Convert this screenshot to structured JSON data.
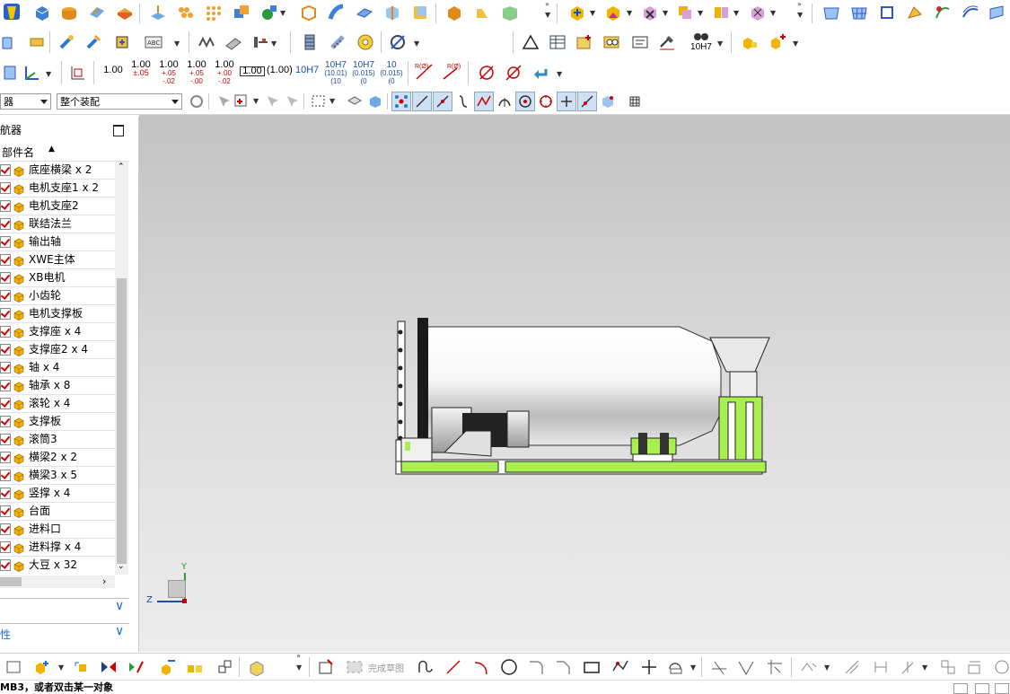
{
  "toolbar_row3": {
    "tolerance_buttons": [
      {
        "main": "1.00",
        "sub": ""
      },
      {
        "main": "1.00",
        "sub": "±.05"
      },
      {
        "main": "1.00",
        "sub": "+.05",
        "sub2": "-.02"
      },
      {
        "main": "1.00",
        "sub": "+.05",
        "sub2": "-.00"
      },
      {
        "main": "1.00",
        "sub": "+.00",
        "sub2": "-.02"
      },
      {
        "main": "1.00",
        "sub": ""
      },
      {
        "main": "(1.00)",
        "sub": ""
      },
      {
        "main": "10H7",
        "sub": ""
      },
      {
        "main": "10H7",
        "sub": "(10.01)",
        "sub2": "(10"
      },
      {
        "main": "10H7",
        "sub": "(0.015)",
        "sub2": "(0"
      },
      {
        "main": "10",
        "sub": "(0.015)",
        "sub2": "(0"
      }
    ],
    "radius_label": "R(Ø)"
  },
  "toolbar_row2": {
    "fit_label": "10H7"
  },
  "selection_bar": {
    "filter_value": "器",
    "scope_value": "整个装配"
  },
  "navigator": {
    "title": "航器",
    "column_header": "部件名",
    "items": [
      {
        "label": "底座横梁 x 2"
      },
      {
        "label": "电机支座1 x 2"
      },
      {
        "label": "电机支座2"
      },
      {
        "label": "联结法兰"
      },
      {
        "label": "输出轴"
      },
      {
        "label": "XWE主体"
      },
      {
        "label": "XB电机"
      },
      {
        "label": "小齿轮"
      },
      {
        "label": "电机支撑板"
      },
      {
        "label": "支撑座 x 4"
      },
      {
        "label": "支撑座2 x 4"
      },
      {
        "label": "轴 x 4"
      },
      {
        "label": "轴承 x 8"
      },
      {
        "label": "滚轮 x 4"
      },
      {
        "label": "支撑板"
      },
      {
        "label": "滚筒3"
      },
      {
        "label": "横梁2 x 2"
      },
      {
        "label": "横梁3 x 5"
      },
      {
        "label": "竖撑 x 4"
      },
      {
        "label": "台面"
      },
      {
        "label": "进料口"
      },
      {
        "label": "进料撑 x 4"
      },
      {
        "label": "大豆 x 32"
      }
    ],
    "panel2_label": "",
    "panel3_label": "性"
  },
  "viewport": {
    "axis_y": "Y",
    "axis_z": "Z"
  },
  "bottom_toolbar": {
    "finish_sketch_label": "完成草图"
  },
  "status_bar": {
    "message": "MB3，或者双击某一对象"
  },
  "colors": {
    "accent_green": "#a8f050",
    "red_check": "#d40000",
    "cube_yellow": "#f0b400"
  }
}
